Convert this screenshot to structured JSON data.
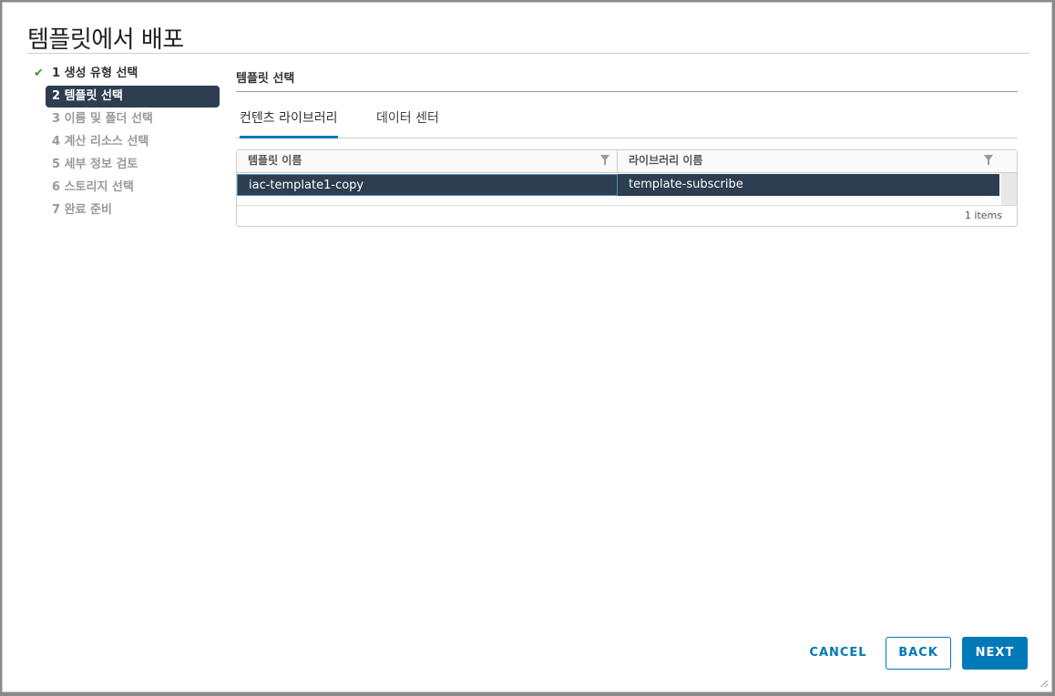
{
  "dialog": {
    "title": "템플릿에서 배포"
  },
  "steps": [
    {
      "label": "1 생성 유형 선택",
      "state": "done"
    },
    {
      "label": "2 템플릿 선택",
      "state": "active"
    },
    {
      "label": "3 이름 및 폴더 선택",
      "state": "pending"
    },
    {
      "label": "4 계산 리소스 선택",
      "state": "pending"
    },
    {
      "label": "5 세부 정보 검토",
      "state": "pending"
    },
    {
      "label": "6 스토리지 선택",
      "state": "pending"
    },
    {
      "label": "7 완료 준비",
      "state": "pending"
    }
  ],
  "content": {
    "section_title": "템플릿 선택",
    "tabs": [
      {
        "label": "컨텐츠 라이브러리",
        "active": true
      },
      {
        "label": "데이터 센터",
        "active": false
      }
    ],
    "grid": {
      "columns": [
        "템플릿 이름",
        "라이브러리 이름"
      ],
      "rows": [
        {
          "template_name": "iac-template1-copy",
          "library_name": "template-subscribe",
          "selected": true
        }
      ],
      "footer": "1 items"
    }
  },
  "buttons": {
    "cancel": "CANCEL",
    "back": "BACK",
    "next": "NEXT"
  },
  "colors": {
    "accent": "#0079b8",
    "selected_row": "#2c3e50",
    "check": "#3c9a2c"
  }
}
